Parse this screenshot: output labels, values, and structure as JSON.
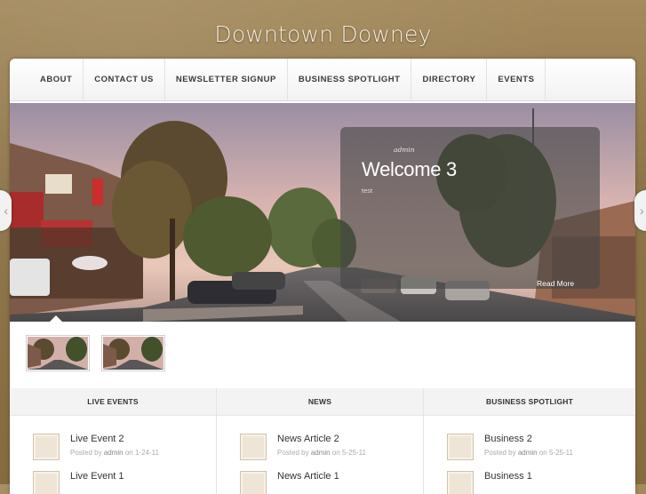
{
  "site": {
    "title": "Downtown Downey"
  },
  "nav": {
    "items": [
      {
        "label": "ABOUT",
        "name": "nav-about"
      },
      {
        "label": "CONTACT US",
        "name": "nav-contact-us"
      },
      {
        "label": "NEWSLETTER SIGNUP",
        "name": "nav-newsletter-signup"
      },
      {
        "label": "BUSINESS SPOTLIGHT",
        "name": "nav-business-spotlight"
      },
      {
        "label": "DIRECTORY",
        "name": "nav-directory"
      },
      {
        "label": "EVENTS",
        "name": "nav-events"
      }
    ]
  },
  "slider": {
    "author": "admin",
    "title": "Welcome 3",
    "text": "test",
    "read_more": "Read More",
    "prev_icon": "chevron-left-icon",
    "next_icon": "chevron-right-icon",
    "prev_glyph": "‹",
    "next_glyph": "›"
  },
  "columns": [
    {
      "heading": "LIVE EVENTS",
      "items": [
        {
          "title": "Live Event 2",
          "posted_by": "Posted by",
          "author": "admin",
          "on": "on 1-24-11"
        },
        {
          "title": "Live Event 1"
        }
      ]
    },
    {
      "heading": "NEWS",
      "items": [
        {
          "title": "News Article 2",
          "posted_by": "Posted by",
          "author": "admin",
          "on": "on 5-25-11"
        },
        {
          "title": "News Article 1"
        }
      ]
    },
    {
      "heading": "BUSINESS SPOTLIGHT",
      "items": [
        {
          "title": "Business 2",
          "posted_by": "Posted by",
          "author": "admin",
          "on": "on 5-25-11"
        },
        {
          "title": "Business 1"
        }
      ]
    }
  ],
  "colors": {
    "background": "#8d7348",
    "caption_bg": "#464646",
    "thumb_box": "#eee5d6"
  }
}
